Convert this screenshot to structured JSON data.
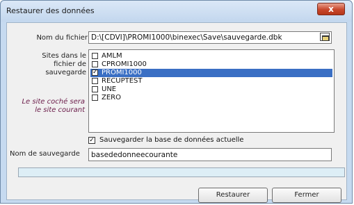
{
  "window": {
    "title": "Restaurer des données",
    "close_label": "x"
  },
  "form": {
    "file_label": "Nom du fichier",
    "file_value": "D:\\[CDVI]\\PROMI1000\\binexec\\Save\\sauvegarde.dbk",
    "sites_label": [
      "Sites dans le",
      "fichier de",
      "sauvegarde"
    ],
    "note_label": [
      "Le site coché sera",
      "le site courant"
    ],
    "sites": [
      {
        "label": "AMLM",
        "checked": false,
        "selected": false
      },
      {
        "label": "CPROMI1000",
        "checked": false,
        "selected": false
      },
      {
        "label": "PROMI1000",
        "checked": true,
        "selected": true
      },
      {
        "label": "RECUPTEST",
        "checked": false,
        "selected": false
      },
      {
        "label": "UNE",
        "checked": false,
        "selected": false
      },
      {
        "label": "ZERO",
        "checked": false,
        "selected": false
      }
    ],
    "save_current_label": "Sauvegarder la base de données actuelle",
    "save_current_checked": true,
    "save_name_label": "Nom de sauvegarde",
    "save_name_value": "basededonneecourante"
  },
  "buttons": {
    "restore": "Restaurer",
    "close": "Fermer"
  },
  "colors": {
    "selection": "#3a6fc4",
    "note_text": "#6a1a48"
  }
}
